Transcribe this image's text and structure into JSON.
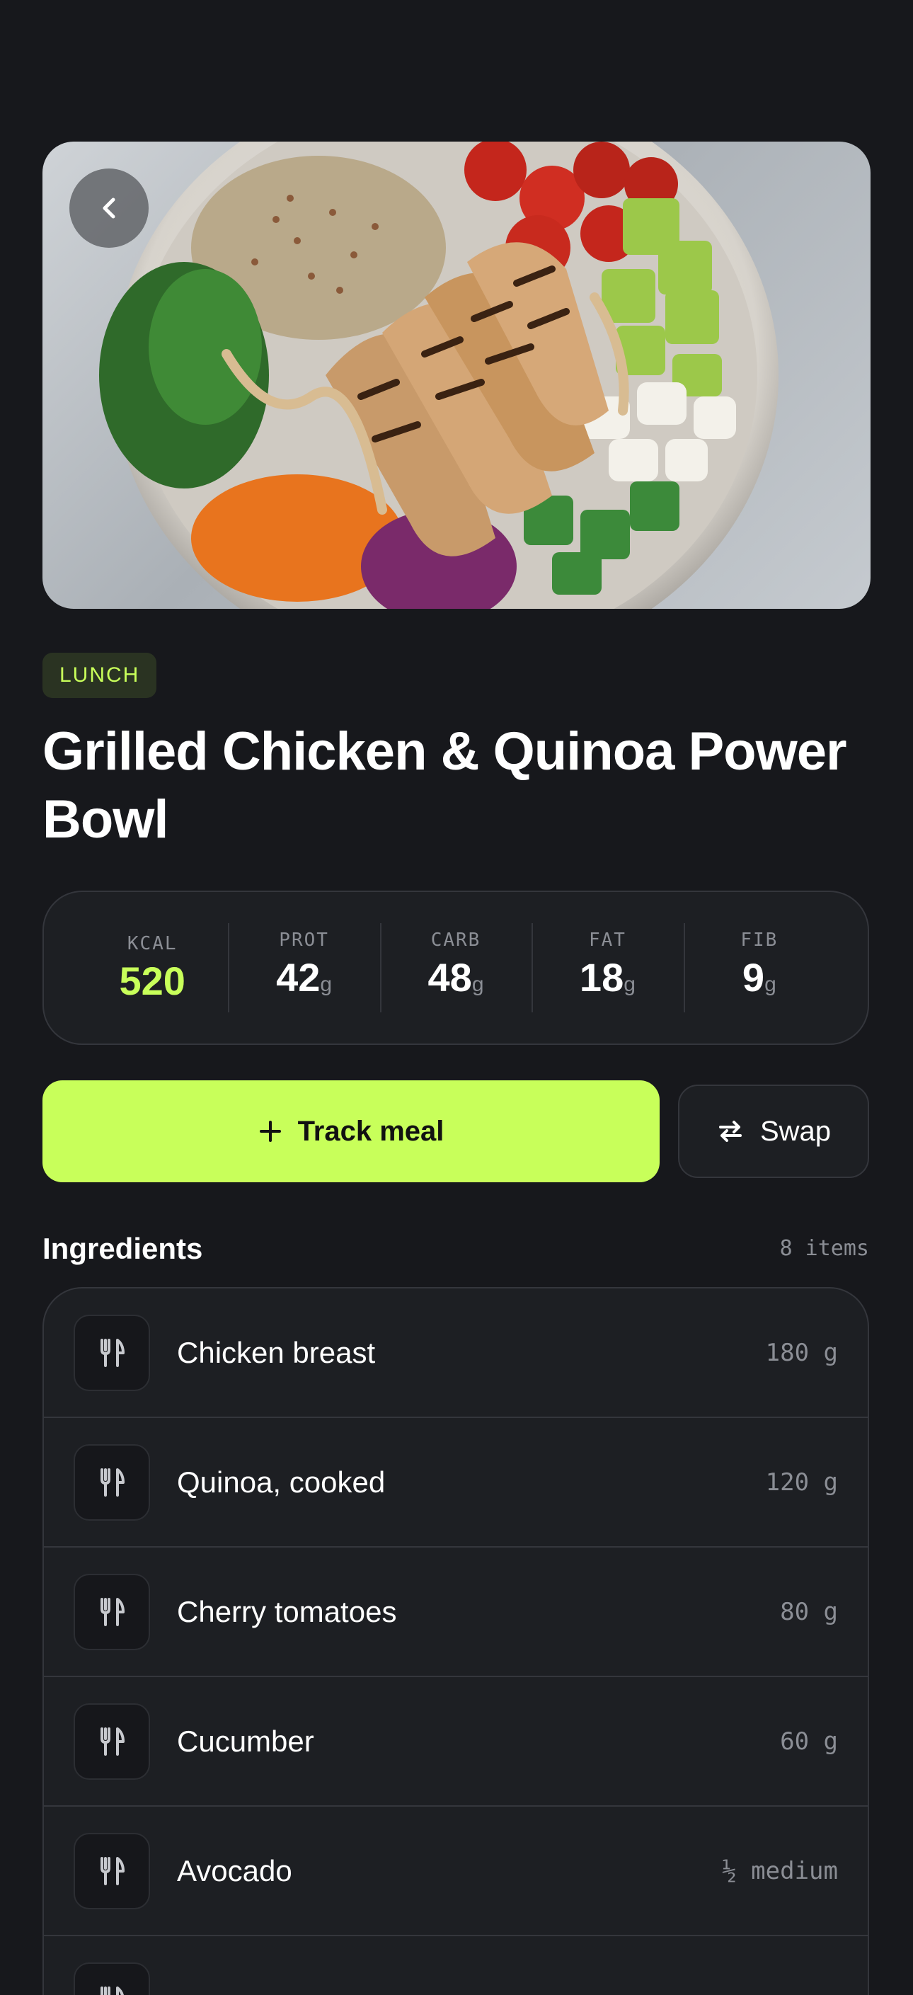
{
  "meal": {
    "badge": "LUNCH",
    "title": "Grilled Chicken & Quinoa Power Bowl"
  },
  "macros": [
    {
      "label": "KCAL",
      "value": "520",
      "unit": ""
    },
    {
      "label": "PROT",
      "value": "42",
      "unit": "g"
    },
    {
      "label": "CARB",
      "value": "48",
      "unit": "g"
    },
    {
      "label": "FAT",
      "value": "18",
      "unit": "g"
    },
    {
      "label": "FIB",
      "value": "9",
      "unit": "g"
    }
  ],
  "actions": {
    "track_label": "Track meal",
    "swap_label": "Swap"
  },
  "ingredients": {
    "title": "Ingredients",
    "count": "8 items",
    "items": [
      {
        "name": "Chicken breast",
        "qty": "180 g"
      },
      {
        "name": "Quinoa, cooked",
        "qty": "120 g"
      },
      {
        "name": "Cherry tomatoes",
        "qty": "80 g"
      },
      {
        "name": "Cucumber",
        "qty": "60 g"
      },
      {
        "name": "Avocado",
        "qty": "½ medium"
      },
      {
        "name": "",
        "qty": ""
      }
    ]
  },
  "icons": {
    "back": "chevron-left-icon",
    "track": "plus-icon",
    "swap": "swap-arrows-icon",
    "ingredient": "fork-knife-icon"
  },
  "colors": {
    "background": "#17181c",
    "accent": "#c8ff5a",
    "card": "#1d1f23",
    "muted": "#8b8e95"
  }
}
